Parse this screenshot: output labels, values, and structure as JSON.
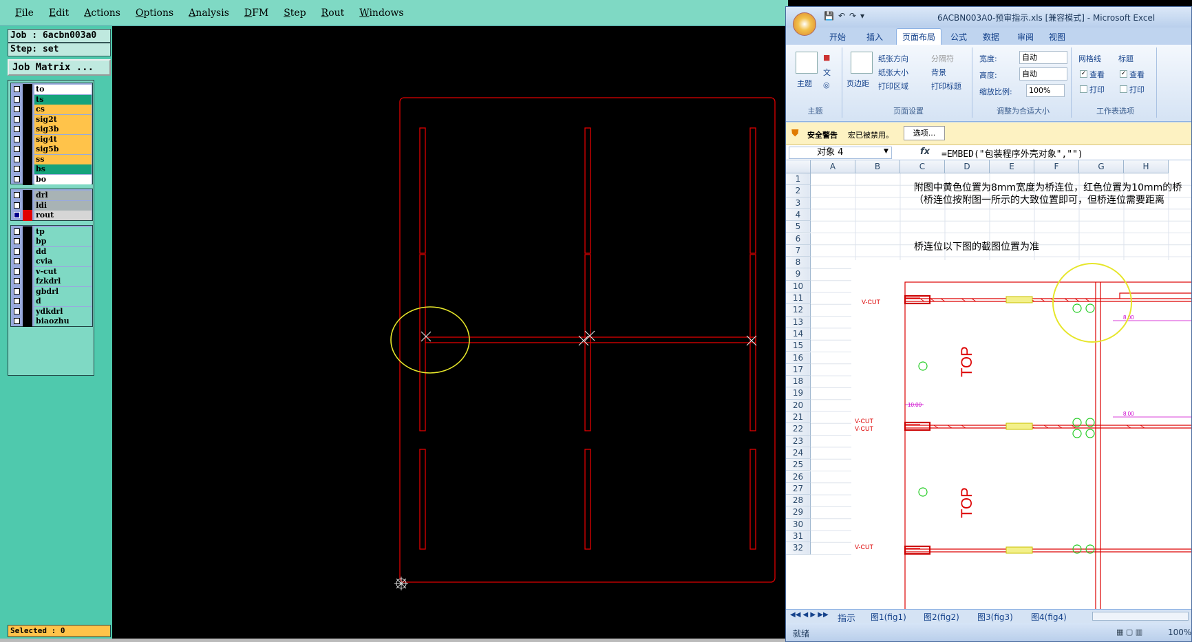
{
  "genesis": {
    "menu": [
      "File",
      "Edit",
      "Actions",
      "Options",
      "Analysis",
      "DFM",
      "Step",
      "Rout",
      "Windows"
    ],
    "job_line": "Job : 6acbn003a0",
    "step_line": "Step: set",
    "job_matrix_button": "Job Matrix ...",
    "layer_groups": [
      [
        {
          "name": "to",
          "color": "#ffffff"
        },
        {
          "name": "ts",
          "color": "#15a37c"
        },
        {
          "name": "cs",
          "color": "#ffc34a"
        },
        {
          "name": "sig2t",
          "color": "#ffc34a"
        },
        {
          "name": "sig3b",
          "color": "#ffc34a"
        },
        {
          "name": "sig4t",
          "color": "#ffc34a"
        },
        {
          "name": "sig5b",
          "color": "#ffc34a"
        },
        {
          "name": "ss",
          "color": "#ffc34a"
        },
        {
          "name": "bs",
          "color": "#15a37c"
        },
        {
          "name": "bo",
          "color": "#ffffff"
        }
      ],
      [
        {
          "name": "drl",
          "color": "#a8b3b5"
        },
        {
          "name": "ldi",
          "color": "#a8b3b5"
        },
        {
          "name": "rout",
          "color": "#d6d6d6",
          "active": true
        }
      ],
      [
        {
          "name": "tp",
          "color": "#7fd9c4"
        },
        {
          "name": "bp",
          "color": "#7fd9c4"
        },
        {
          "name": "dd",
          "color": "#7fd9c4"
        },
        {
          "name": "cvia",
          "color": "#7fd9c4"
        },
        {
          "name": "v-cut",
          "color": "#7fd9c4"
        },
        {
          "name": "fzkdrl",
          "color": "#7fd9c4"
        },
        {
          "name": "gbdrl",
          "color": "#7fd9c4"
        },
        {
          "name": "d",
          "color": "#7fd9c4"
        },
        {
          "name": "ydkdrl",
          "color": "#7fd9c4"
        },
        {
          "name": "biaozhu",
          "color": "#7fd9c4"
        }
      ]
    ],
    "selected_status": "Selected : 0",
    "colors": {
      "outline": "#e00000",
      "highlight": "#e6e62a",
      "panel": "#4fc9ad"
    }
  },
  "excel": {
    "window_title": "6ACBN003A0-预审指示.xls [兼容模式] - Microsoft Excel",
    "ribbon_tabs": [
      "开始",
      "插入",
      "页面布局",
      "公式",
      "数据",
      "审阅",
      "视图"
    ],
    "active_tab": "页面布局",
    "ribbon": {
      "theme_label": "主题",
      "theme_group": "主题",
      "margins_label": "页边距",
      "orientation": "纸张方向",
      "size": "纸张大小",
      "print_area": "打印区域",
      "breaks": "分隔符",
      "background": "背景",
      "print_titles": "打印标题",
      "page_setup_group": "页面设置",
      "width_label": "宽度:",
      "width_value": "自动",
      "height_label": "高度:",
      "height_value": "自动",
      "scale_label": "缩放比例:",
      "scale_value": "100%",
      "fit_group": "调整为合适大小",
      "gridlines": "网格线",
      "headings": "标题",
      "view": "查看",
      "print": "打印",
      "sheet_options_group": "工作表选项"
    },
    "security": {
      "title": "安全警告",
      "message": "宏已被禁用。",
      "button": "选项..."
    },
    "name_box": "对象 4",
    "formula": "=EMBED(\"包装程序外壳对象\",\"\")",
    "columns": [
      "A",
      "B",
      "C",
      "D",
      "E",
      "F",
      "G",
      "H"
    ],
    "rows": [
      "1",
      "2",
      "3",
      "4",
      "5",
      "6",
      "7",
      "8",
      "9",
      "10",
      "11",
      "12",
      "13",
      "14",
      "15",
      "16",
      "17",
      "18",
      "19",
      "20",
      "21",
      "22",
      "23",
      "24",
      "25",
      "26",
      "27",
      "28",
      "29",
      "30",
      "31",
      "32"
    ],
    "cells": {
      "row2": "附图中黄色位置为8mm宽度为桥连位，红色位置为10mm的桥",
      "row3": "（桥连位按附图一所示的大致位置即可，但桥连位需要距离",
      "row7": "桥连位以下图的截图位置为准"
    },
    "embedded_labels": {
      "vcut": "V-CUT",
      "top": "TOP",
      "dim8": "8.00",
      "dim10": "10.00"
    },
    "sheet_tabs": [
      "指示",
      "图1(fig1)",
      "图2(fig2)",
      "图3(fig3)",
      "图4(fig4)"
    ],
    "status_ready": "就绪",
    "zoom": "100%"
  }
}
